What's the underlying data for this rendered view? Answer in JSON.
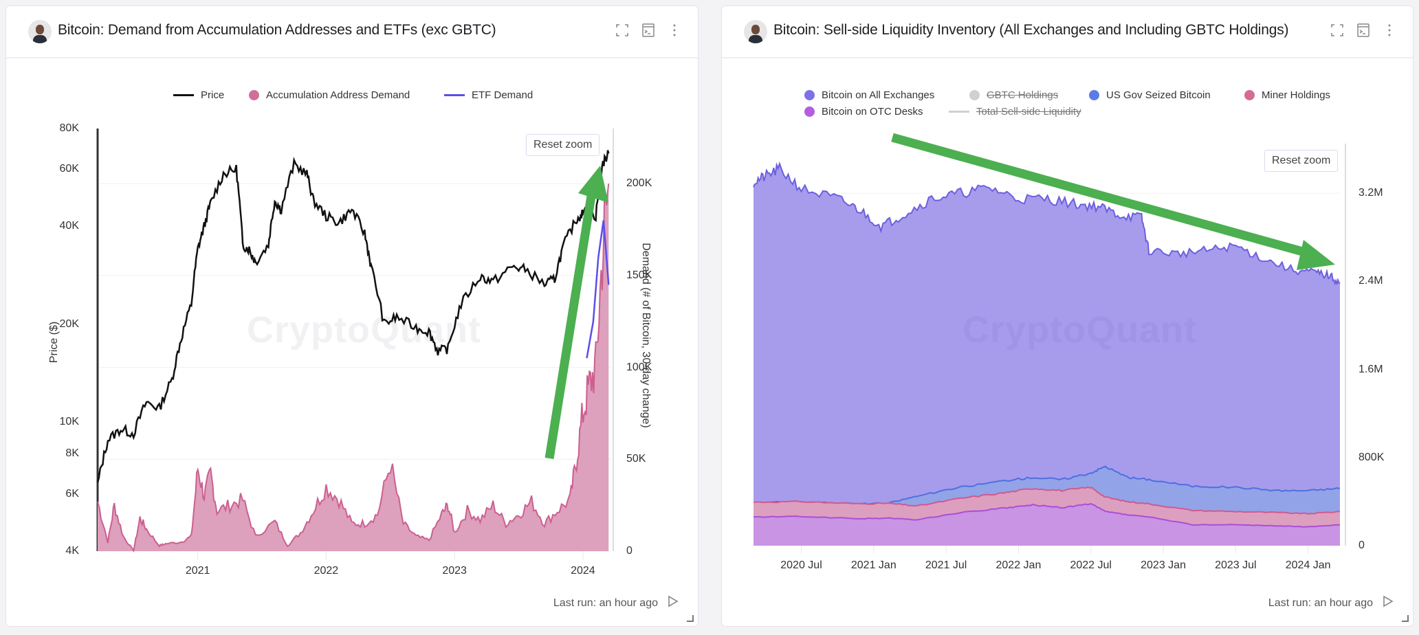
{
  "cards": [
    {
      "title": "Bitcoin: Demand from Accumulation Addresses and ETFs (exc GBTC)",
      "icons": [
        "fullscreen-icon",
        "terminal-icon",
        "more-vertical-icon"
      ],
      "reset_zoom_label": "Reset zoom",
      "watermark": "CryptoQuant",
      "footer": {
        "last_run": "Last run: an hour ago",
        "run_icon": "play-icon"
      }
    },
    {
      "title": "Bitcoin: Sell-side Liquidity Inventory (All Exchanges and Including GBTC Holdings)",
      "icons": [
        "fullscreen-icon",
        "terminal-icon",
        "more-vertical-icon"
      ],
      "reset_zoom_label": "Reset zoom",
      "watermark": "CryptoQuant",
      "footer": {
        "last_run": "Last run: an hour ago",
        "run_icon": "play-icon"
      }
    }
  ],
  "annotations": {
    "left_arrow": {
      "color": "#4caf50",
      "direction": "up",
      "meaning": "demand surging"
    },
    "right_arrow": {
      "color": "#4caf50",
      "direction": "down",
      "meaning": "sell-side liquidity declining"
    }
  },
  "chart_data": [
    {
      "type": "line",
      "title": "Bitcoin: Demand from Accumulation Addresses and ETFs (exc GBTC)",
      "legend": [
        {
          "name": "Price",
          "marker": "line",
          "color": "#111111"
        },
        {
          "name": "Accumulation Address Demand",
          "marker": "dot",
          "color": "#d0709a"
        },
        {
          "name": "ETF Demand",
          "marker": "line",
          "color": "#5b4de8"
        }
      ],
      "legend_position": "top-center",
      "xlabel": "",
      "x_ticks": [
        "2021",
        "2022",
        "2023",
        "2024"
      ],
      "x_range": [
        2020.22,
        2024.22
      ],
      "y_left": {
        "label": "Price ($)",
        "scale": "log",
        "ticks": [
          "4K",
          "6K",
          "8K",
          "10K",
          "20K",
          "40K",
          "60K",
          "80K"
        ],
        "tick_values": [
          4000,
          6000,
          8000,
          10000,
          20000,
          40000,
          60000,
          80000
        ],
        "range": [
          4000,
          80000
        ]
      },
      "y_right": {
        "label": "Demand (# of Bitcoin, 30-day change)",
        "ticks": [
          "0",
          "50K",
          "100K",
          "150K",
          "200K"
        ],
        "tick_values": [
          0,
          50000,
          100000,
          150000,
          200000
        ],
        "range": [
          0,
          230000
        ]
      },
      "series": [
        {
          "name": "Price",
          "axis": "left",
          "x": [
            2020.22,
            2020.3,
            2020.4,
            2020.5,
            2020.6,
            2020.7,
            2020.8,
            2020.87,
            2020.95,
            2021.0,
            2021.05,
            2021.1,
            2021.2,
            2021.3,
            2021.35,
            2021.4,
            2021.45,
            2021.55,
            2021.6,
            2021.65,
            2021.75,
            2021.85,
            2021.9,
            2022.0,
            2022.1,
            2022.2,
            2022.3,
            2022.35,
            2022.45,
            2022.55,
            2022.7,
            2022.8,
            2022.87,
            2022.95,
            2023.05,
            2023.2,
            2023.3,
            2023.45,
            2023.55,
            2023.7,
            2023.78,
            2023.85,
            2023.95,
            2024.0,
            2024.1,
            2024.15,
            2024.2
          ],
          "y": [
            6400,
            8800,
            9500,
            9200,
            11500,
            11000,
            13500,
            18000,
            23000,
            34000,
            40000,
            47000,
            58000,
            60000,
            35000,
            34000,
            31000,
            35000,
            48000,
            45000,
            62000,
            58000,
            48000,
            43000,
            41000,
            45000,
            38000,
            30000,
            20000,
            21000,
            19500,
            19000,
            16500,
            16800,
            23000,
            28000,
            27000,
            30000,
            29500,
            26500,
            27500,
            35000,
            42000,
            44000,
            43000,
            62000,
            67000
          ]
        },
        {
          "name": "Accumulation Address Demand",
          "axis": "right",
          "x": [
            2020.22,
            2020.3,
            2020.35,
            2020.42,
            2020.5,
            2020.55,
            2020.6,
            2020.7,
            2020.75,
            2020.87,
            2020.95,
            2021.0,
            2021.05,
            2021.1,
            2021.15,
            2021.25,
            2021.35,
            2021.45,
            2021.6,
            2021.7,
            2021.8,
            2021.9,
            2022.0,
            2022.1,
            2022.2,
            2022.3,
            2022.4,
            2022.5,
            2022.6,
            2022.7,
            2022.8,
            2022.9,
            2022.95,
            2023.0,
            2023.1,
            2023.2,
            2023.3,
            2023.4,
            2023.5,
            2023.6,
            2023.7,
            2023.8,
            2023.9,
            2023.95,
            2024.0,
            2024.05,
            2024.1,
            2024.15,
            2024.2
          ],
          "y": [
            27000,
            5000,
            25000,
            8000,
            0,
            18000,
            12000,
            3000,
            4000,
            5000,
            8000,
            45000,
            30000,
            42000,
            22000,
            25000,
            28000,
            8000,
            16000,
            3000,
            10000,
            22000,
            35000,
            28000,
            15000,
            15000,
            20000,
            48000,
            15000,
            8000,
            6000,
            20000,
            25000,
            10000,
            22000,
            17000,
            25000,
            15000,
            20000,
            27000,
            15000,
            22000,
            28000,
            50000,
            75000,
            90000,
            100000,
            160000,
            200000
          ]
        },
        {
          "name": "ETF Demand",
          "axis": "right",
          "x": [
            2024.03,
            2024.08,
            2024.12,
            2024.16,
            2024.2
          ],
          "y": [
            105000,
            125000,
            160000,
            180000,
            145000
          ]
        }
      ]
    },
    {
      "type": "area",
      "stacked": true,
      "title": "Bitcoin: Sell-side Liquidity Inventory (All Exchanges and Including GBTC Holdings)",
      "legend": [
        {
          "name": "Bitcoin on All Exchanges",
          "marker": "dot",
          "color": "#7b72e8",
          "visible": true
        },
        {
          "name": "GBTC Holdings",
          "marker": "dot",
          "color": "#cfcfd6",
          "visible": false
        },
        {
          "name": "US Gov Seized Bitcoin",
          "marker": "dot",
          "color": "#5b7be6",
          "visible": true
        },
        {
          "name": "Miner Holdings",
          "marker": "dot",
          "color": "#d56a95",
          "visible": true
        },
        {
          "name": "Bitcoin on OTC Desks",
          "marker": "dot",
          "color": "#b45ee0",
          "visible": true
        },
        {
          "name": "Total Sell-side Liquidity",
          "marker": "line",
          "color": "#cfcfd6",
          "visible": false
        }
      ],
      "legend_position": "top-center",
      "x_ticks": [
        "2020 Jul",
        "2021 Jan",
        "2021 Jul",
        "2022 Jan",
        "2022 Jul",
        "2023 Jan",
        "2023 Jul",
        "2024 Jan"
      ],
      "x_range": [
        2020.17,
        2024.22
      ],
      "y_axis": {
        "side": "right",
        "ticks": [
          "0",
          "800K",
          "1.6M",
          "2.4M",
          "3.2M"
        ],
        "tick_values": [
          0,
          800000,
          1600000,
          2400000,
          3200000
        ],
        "range": [
          0,
          3650000
        ]
      },
      "series_cumulative": [
        {
          "name": "Bitcoin on OTC Desks",
          "x": [
            2020.17,
            2020.5,
            2020.9,
            2021.1,
            2021.3,
            2021.6,
            2021.9,
            2022.1,
            2022.3,
            2022.5,
            2022.6,
            2022.75,
            2022.9,
            2023.2,
            2023.5,
            2023.8,
            2024.0,
            2024.22
          ],
          "y": [
            260000,
            265000,
            245000,
            250000,
            235000,
            300000,
            340000,
            370000,
            345000,
            380000,
            310000,
            280000,
            260000,
            190000,
            190000,
            180000,
            170000,
            190000
          ]
        },
        {
          "name": "Miner Holdings",
          "x": [
            2020.17,
            2020.5,
            2020.9,
            2021.1,
            2021.3,
            2021.6,
            2021.9,
            2022.1,
            2022.3,
            2022.5,
            2022.6,
            2022.75,
            2022.9,
            2023.2,
            2023.5,
            2023.8,
            2024.0,
            2024.22
          ],
          "y": [
            395000,
            400000,
            380000,
            385000,
            360000,
            430000,
            480000,
            520000,
            500000,
            530000,
            440000,
            400000,
            380000,
            320000,
            310000,
            300000,
            290000,
            310000
          ]
        },
        {
          "name": "US Gov Seized Bitcoin",
          "x": [
            2020.17,
            2020.5,
            2020.9,
            2021.1,
            2021.3,
            2021.6,
            2021.9,
            2022.1,
            2022.3,
            2022.5,
            2022.6,
            2022.75,
            2022.9,
            2023.2,
            2023.5,
            2023.8,
            2024.0,
            2024.22
          ],
          "y": [
            395000,
            400000,
            380000,
            385000,
            450000,
            530000,
            590000,
            620000,
            600000,
            660000,
            720000,
            620000,
            600000,
            540000,
            530000,
            500000,
            500000,
            520000
          ]
        },
        {
          "name": "Bitcoin on All Exchanges",
          "x": [
            2020.17,
            2020.25,
            2020.35,
            2020.5,
            2020.75,
            2020.9,
            2021.05,
            2021.2,
            2021.4,
            2021.6,
            2021.8,
            2022.0,
            2022.2,
            2022.4,
            2022.55,
            2022.7,
            2022.85,
            2022.9,
            2023.1,
            2023.3,
            2023.5,
            2023.7,
            2023.9,
            2024.05,
            2024.15,
            2024.22
          ],
          "y": [
            3300000,
            3350000,
            3420000,
            3240000,
            3150000,
            3050000,
            2900000,
            3000000,
            3150000,
            3200000,
            3250000,
            3150000,
            3150000,
            3100000,
            3080000,
            3000000,
            2980000,
            2680000,
            2650000,
            2680000,
            2720000,
            2600000,
            2500000,
            2480000,
            2450000,
            2380000
          ]
        }
      ]
    }
  ]
}
